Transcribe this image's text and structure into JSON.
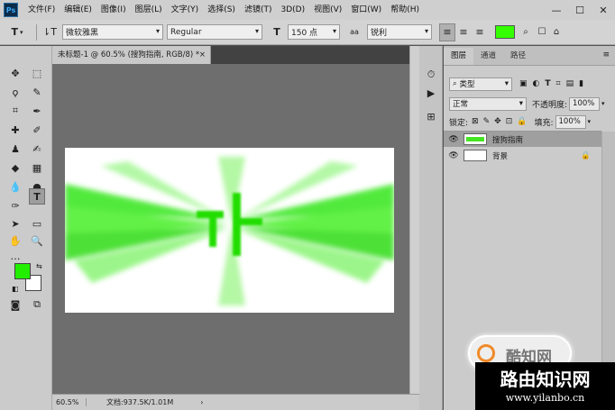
{
  "menu": {
    "logo": "Ps",
    "items": [
      "文件(F)",
      "编辑(E)",
      "图像(I)",
      "图层(L)",
      "文字(Y)",
      "选择(S)",
      "滤镜(T)",
      "3D(D)",
      "视图(V)",
      "窗口(W)",
      "帮助(H)"
    ],
    "controls": [
      "—",
      "☐",
      "✕"
    ]
  },
  "options": {
    "tool_icon": "T",
    "font_family": "微软雅黑",
    "font_style": "Regular",
    "size_icon": "T",
    "font_size": "150 点",
    "aa_icon": "aa",
    "antialias": "锐利",
    "text_color": "#33ff00"
  },
  "document": {
    "tab_title": "未标题-1 @ 60.5% (搜狗指南, RGB/8) *",
    "close": "×",
    "zoom": "60.5%",
    "doc_info": "文档:937.5K/1.01M",
    "status_arrow": "›"
  },
  "tools": {
    "foreground_color": "#22ee00",
    "background_color": "#ffffff"
  },
  "layers_panel": {
    "tabs": [
      "图层",
      "通道",
      "路径"
    ],
    "filter_label": "类型",
    "blend_mode": "正常",
    "opacity_label": "不透明度:",
    "opacity_value": "100%",
    "lock_label": "锁定:",
    "fill_label": "填充:",
    "fill_value": "100%",
    "layers": [
      {
        "name": "搜狗指南",
        "selected": true
      },
      {
        "name": "背景",
        "selected": false
      }
    ]
  },
  "watermark": {
    "line1": "酷知网",
    "line2": "路由知识网",
    "line3": "www.yilanbo.cn"
  }
}
